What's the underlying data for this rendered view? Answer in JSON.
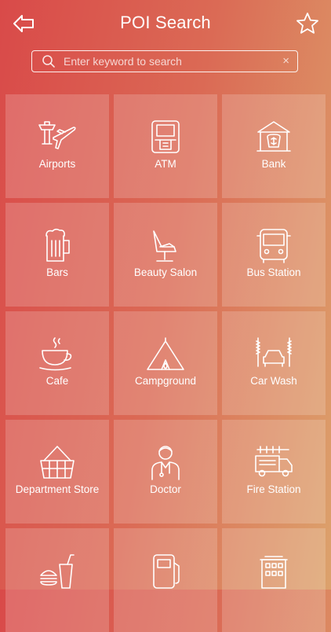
{
  "header": {
    "title": "POI Search",
    "back_icon": "arrow-left-icon",
    "favorite_icon": "star-icon"
  },
  "search": {
    "placeholder": "Enter keyword to search",
    "value": "",
    "clear_label": "×"
  },
  "categories": [
    {
      "label": "Airports",
      "icon": "airport-icon"
    },
    {
      "label": "ATM",
      "icon": "atm-icon"
    },
    {
      "label": "Bank",
      "icon": "bank-icon"
    },
    {
      "label": "Bars",
      "icon": "beer-mug-icon"
    },
    {
      "label": "Beauty Salon",
      "icon": "salon-chair-icon"
    },
    {
      "label": "Bus Station",
      "icon": "bus-icon"
    },
    {
      "label": "Cafe",
      "icon": "coffee-cup-icon"
    },
    {
      "label": "Campground",
      "icon": "tent-icon"
    },
    {
      "label": "Car Wash",
      "icon": "car-wash-icon"
    },
    {
      "label": "Department Store",
      "icon": "shopping-basket-icon"
    },
    {
      "label": "Doctor",
      "icon": "doctor-icon"
    },
    {
      "label": "Fire Station",
      "icon": "fire-truck-icon"
    },
    {
      "label": "",
      "icon": "fast-food-icon"
    },
    {
      "label": "",
      "icon": "gas-pump-icon"
    },
    {
      "label": "",
      "icon": "hotel-building-icon"
    }
  ],
  "colors": {
    "gradient_start": "#d94a49",
    "gradient_end": "#dca26c",
    "text": "#ffffff"
  }
}
